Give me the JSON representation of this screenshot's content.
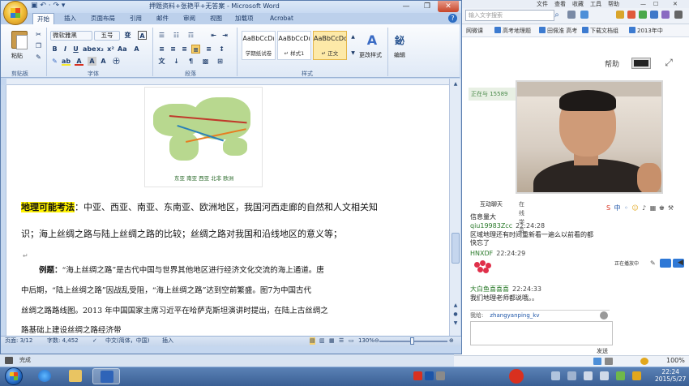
{
  "word": {
    "window_title": "押题资料+张艳平+无答案 - Microsoft Word",
    "quick_access": "▣ ↶ · ↷ ▾",
    "tabs": [
      "开始",
      "插入",
      "页面布局",
      "引用",
      "邮件",
      "审阅",
      "视图",
      "加载项",
      "Acrobat"
    ],
    "clipboard": {
      "paste_label": "粘贴",
      "group_label": "剪贴板"
    },
    "font": {
      "name": "微软雅黑",
      "size": "五号",
      "group_label": "字体"
    },
    "paragraph": {
      "group_label": "段落"
    },
    "styles": {
      "items": [
        {
          "sample": "AaBbCcDı",
          "name": "学期纸试卷"
        },
        {
          "sample": "AaBbCcDı",
          "name": "↵ 样式1"
        },
        {
          "sample": "AaBbCcDd",
          "name": "↵ 正文"
        }
      ],
      "change_styles_label": "更改样式",
      "group_label": "样式"
    },
    "editing": {
      "label": "编辑"
    },
    "document": {
      "map_caption": "东亚 南亚 西亚 北非 欧洲",
      "line1_highlight": "地理可能考法",
      "line1_rest": "：中亚、西亚、南亚、东南亚、欧洲地区，我国河西走廊的自然和人文相关知",
      "line2": "识；海上丝绸之路与陆上丝绸之路的比较；丝绸之路对我国和沿线地区的意义等；",
      "para_mark": "↵",
      "example_label": "例题：",
      "example_line1": "“海上丝绸之路”是古代中国与世界其他地区进行经济文化交流的海上通道。唐",
      "example_line2": "中后期，“陆上丝绸之路”因战乱受阻，“海上丝绸之路”达到空前繁盛。图7为中国古代",
      "example_line3": "丝绸之路路线图。2013 年中国国家主席习近平在哈萨克斯坦演讲时提出，在陆上古丝绸之",
      "example_line4": "路基础上建设丝绸之路经济带"
    },
    "status": {
      "page": "页面: 3/12",
      "words": "字数: 4,452",
      "language": "中文(简体，中国)",
      "insert": "插入",
      "zoom": "130%",
      "below": "完成"
    }
  },
  "browser": {
    "menu": [
      "文件",
      "查看",
      "收藏",
      "工具",
      "帮助"
    ],
    "search_placeholder": "输入文字搜索",
    "favorites": [
      "网微课",
      "高考地理题",
      "田佩淮 高考",
      "下载文档组",
      "2013年中"
    ],
    "help_label": "帮助",
    "live_strip": "正在与 15589",
    "zoom": "100%"
  },
  "chat": {
    "tabs": [
      "互动聊天",
      "在线学员"
    ],
    "messages": [
      {
        "type": "msg",
        "text": "信息量大"
      },
      {
        "type": "name",
        "user": "qiu19983Zcc",
        "time": "22:24:28"
      },
      {
        "type": "msg",
        "text": "区域地理还有时间重新看一遍么以前看的都"
      },
      {
        "type": "msg",
        "text": "快忘了"
      },
      {
        "type": "name",
        "user": "HNXDF",
        "time": "22:24:29"
      },
      {
        "type": "name",
        "user": "大白鱼喜喜喜",
        "time": "22:24:33"
      },
      {
        "type": "msg",
        "text": "我们地理老师都说哦。。"
      }
    ],
    "side_label": "正在播放中",
    "input_prefix": "我给:",
    "input_to": "zhangyanping_kv",
    "send_label": "发送"
  },
  "taskbar": {
    "time": "22:24",
    "date": "2015/5/27"
  },
  "colors": {
    "highlight": "#fff200",
    "ribbon_blue": "#c5d7ef",
    "taskbar": "#3a5f94"
  }
}
